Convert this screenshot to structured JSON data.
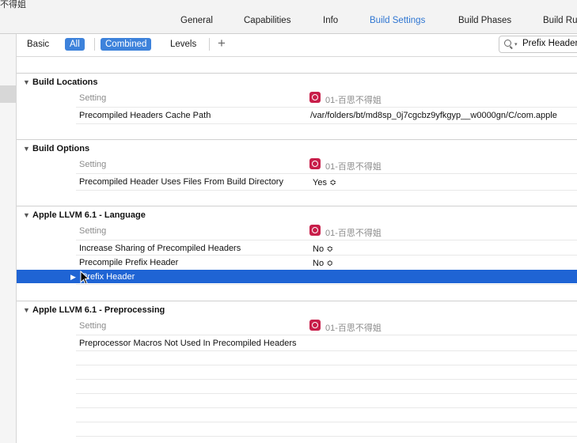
{
  "window": {
    "title_fragment": "不得姐"
  },
  "top_tabs": [
    {
      "label": "General",
      "active": false
    },
    {
      "label": "Capabilities",
      "active": false
    },
    {
      "label": "Info",
      "active": false
    },
    {
      "label": "Build Settings",
      "active": true
    },
    {
      "label": "Build Phases",
      "active": false
    },
    {
      "label": "Build Ru",
      "active": false
    }
  ],
  "filter_bar": {
    "basic": "Basic",
    "all": "All",
    "combined": "Combined",
    "levels": "Levels",
    "add": "+",
    "search_value": "Prefix Header"
  },
  "sections": [
    {
      "title": "Build Locations",
      "column_header": "Setting",
      "target": "01-百思不得姐",
      "rows": [
        {
          "name": "Precompiled Headers Cache Path",
          "value": "/var/folders/bt/md8sp_0j7cgcbz9yfkgyp__w0000gn/C/com.apple"
        }
      ]
    },
    {
      "title": "Build Options",
      "column_header": "Setting",
      "target": "01-百思不得姐",
      "rows": [
        {
          "name": "Precompiled Header Uses Files From Build Directory",
          "value": "Yes ≎"
        }
      ]
    },
    {
      "title": "Apple LLVM 6.1 - Language",
      "column_header": "Setting",
      "target": "01-百思不得姐",
      "rows": [
        {
          "name": "Increase Sharing of Precompiled Headers",
          "value": "No ≎"
        },
        {
          "name": "Precompile Prefix Header",
          "value": "No ≎"
        }
      ],
      "selected_row": {
        "name": "Prefix Header"
      }
    },
    {
      "title": "Apple LLVM 6.1 - Preprocessing",
      "column_header": "Setting",
      "target": "01-百思不得姐",
      "rows": [
        {
          "name": "Preprocessor Macros Not Used In Precompiled Headers",
          "value": ""
        }
      ]
    }
  ],
  "colors": {
    "accent": "#2f76d2",
    "selection": "#1f64d4",
    "target_icon": "#c81e4a"
  }
}
